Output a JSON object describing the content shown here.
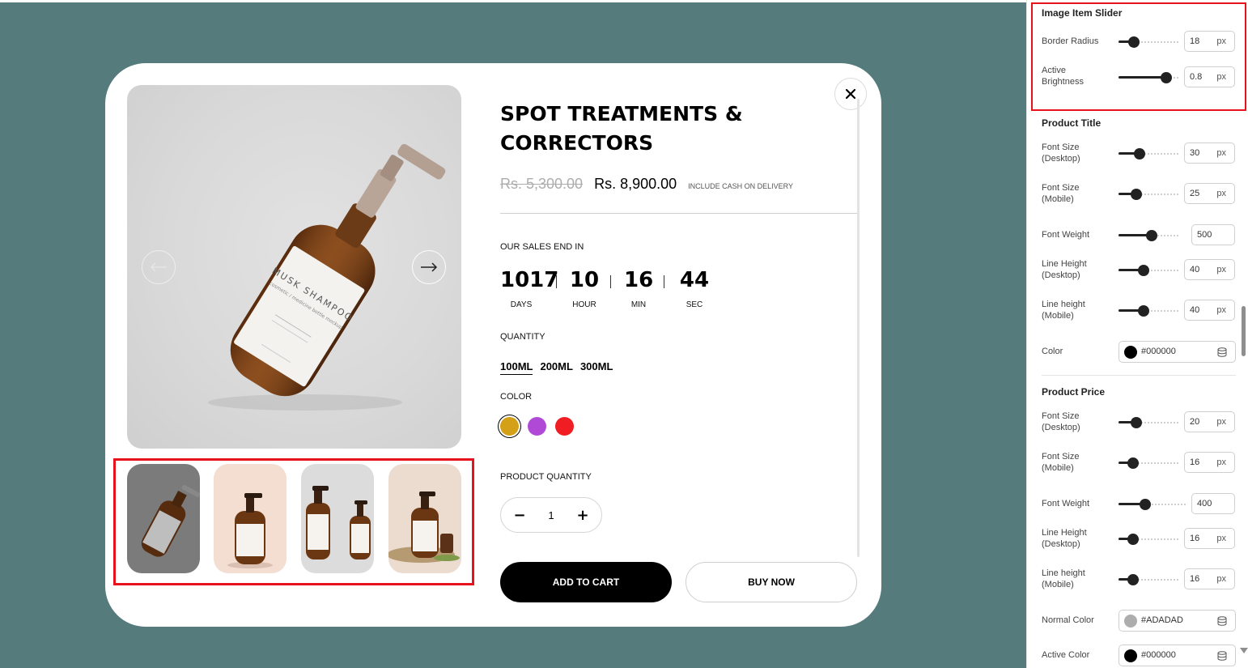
{
  "product": {
    "title": "SPOT TREATMENTS & CORRECTORS",
    "price_old": "Rs. 5,300.00",
    "price_new": "Rs. 8,900.00",
    "price_note": "INCLUDE CASH ON DELIVERY",
    "bottle_label": "MUSK SHAMPOO",
    "bottle_sublabel": "cosmetic / medicine bottle mockup"
  },
  "countdown": {
    "label": "OUR SALES END IN",
    "days": "1017",
    "days_label": "DAYS",
    "hours": "10",
    "hours_label": "HOUR",
    "minutes": "16",
    "minutes_label": "MIN",
    "seconds": "44",
    "seconds_label": "SEC"
  },
  "quantity": {
    "label": "QUANTITY",
    "options": [
      "100ML",
      "200ML",
      "300ML"
    ],
    "selected": "100ML"
  },
  "color": {
    "label": "COLOR",
    "options": [
      "#d4a017",
      "#b04ad6",
      "#f01d22"
    ],
    "selected": "#d4a017"
  },
  "product_quantity": {
    "label": "PRODUCT QUANTITY",
    "value": "1",
    "minus": "−",
    "plus": "+"
  },
  "buttons": {
    "add_to_cart": "ADD TO CART",
    "buy_now": "BUY NOW"
  },
  "colors": {
    "preview_bg": "#557b7c",
    "highlight": "#e8121c"
  },
  "settings": {
    "image_slider": {
      "title": "Image Item Slider",
      "border_radius_label": "Border Radius",
      "border_radius": "18",
      "border_radius_level": 0.25,
      "brightness_label": "Active Brightness",
      "brightness": "0.8",
      "brightness_level": 0.8
    },
    "product_title": {
      "title": "Product Title",
      "fs_desktop_label": "Font Size (Desktop)",
      "fs_desktop": "30",
      "fs_desktop_level": 0.35,
      "fs_mobile_label": "Font Size (Mobile)",
      "fs_mobile": "25",
      "fs_mobile_level": 0.3,
      "fw_label": "Font Weight",
      "fw": "500",
      "fw_level": 0.55,
      "lh_desktop_label": "Line Height (Desktop)",
      "lh_desktop": "40",
      "lh_desktop_level": 0.42,
      "lh_mobile_label": "Line height (Mobile)",
      "lh_mobile": "40",
      "lh_mobile_level": 0.42,
      "color_label": "Color",
      "color": "#000000"
    },
    "product_price": {
      "title": "Product Price",
      "fs_desktop_label": "Font Size (Desktop)",
      "fs_desktop": "20",
      "fs_desktop_level": 0.3,
      "fs_mobile_label": "Font Size (Mobile)",
      "fs_mobile": "16",
      "fs_mobile_level": 0.24,
      "fw_label": "Font Weight",
      "fw": "400",
      "fw_level": 0.4,
      "lh_desktop_label": "Line Height (Desktop)",
      "lh_desktop": "16",
      "lh_desktop_level": 0.24,
      "lh_mobile_label": "Line height (Mobile)",
      "lh_mobile": "16",
      "lh_mobile_level": 0.24,
      "normal_color_label": "Normal Color",
      "normal_color": "#ADADAD",
      "active_color_label": "Active Color",
      "active_color": "#000000"
    },
    "unit": "px"
  }
}
